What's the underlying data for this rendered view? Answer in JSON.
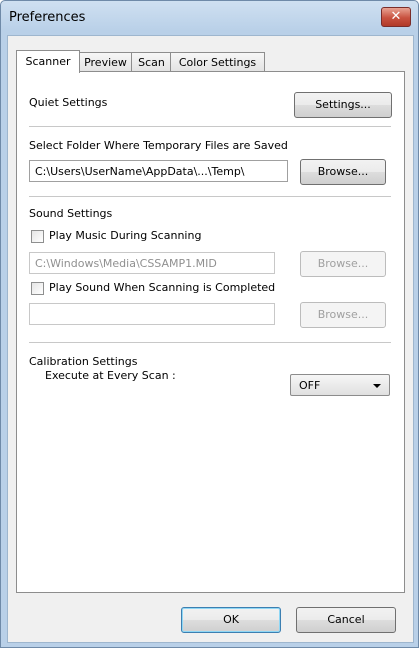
{
  "window": {
    "title": "Preferences"
  },
  "tabs": [
    {
      "label": "Scanner"
    },
    {
      "label": "Preview"
    },
    {
      "label": "Scan"
    },
    {
      "label": "Color Settings"
    }
  ],
  "quiet": {
    "label": "Quiet Settings",
    "button": "Settings..."
  },
  "temp_folder": {
    "label": "Select Folder Where Temporary Files are Saved",
    "path": "C:\\Users\\UserName\\AppData\\...\\Temp\\",
    "browse": "Browse..."
  },
  "sound": {
    "label": "Sound Settings",
    "play_music_label": "Play Music During Scanning",
    "play_music_checked": false,
    "music_path": "C:\\Windows\\Media\\CSSAMP1.MID",
    "music_browse": "Browse...",
    "play_sound_label": "Play Sound When Scanning is Completed",
    "play_sound_checked": false,
    "sound_path": "",
    "sound_browse": "Browse..."
  },
  "calibration": {
    "label": "Calibration Settings",
    "execute_label": "Execute at Every Scan :",
    "execute_value": "OFF"
  },
  "footer": {
    "ok": "OK",
    "cancel": "Cancel"
  },
  "colors": {
    "title_gradient": "#cfe0f1",
    "close": "#c8513f",
    "dialog_bg": "#f0f0f0"
  }
}
